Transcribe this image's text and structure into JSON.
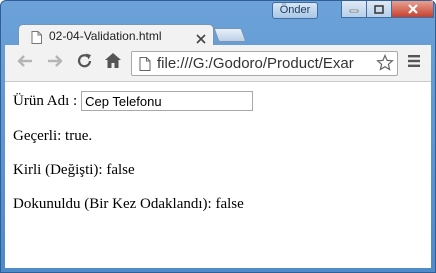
{
  "titlebar": {
    "user_badge": "Önder"
  },
  "tab": {
    "title": "02-04-Validation.html"
  },
  "toolbar": {
    "url": "file:///G:/Godoro/Product/Exar"
  },
  "content": {
    "field_label": "Ürün Adı :",
    "field_value": "Cep Telefonu",
    "valid_text": "Geçerli: true.",
    "dirty_text": "Kirli (Değişti): false",
    "touched_text": "Dokunuldu (Bir Kez Odaklandı): false"
  },
  "colors": {
    "frame": "#6ca2d9",
    "close_button": "#c6412c",
    "toolbar": "#f2f2f2"
  },
  "icons": [
    "page-icon",
    "close-icon",
    "back-icon",
    "forward-icon",
    "reload-icon",
    "home-icon",
    "star-icon",
    "menu-icon",
    "minimize-icon",
    "maximize-icon"
  ]
}
